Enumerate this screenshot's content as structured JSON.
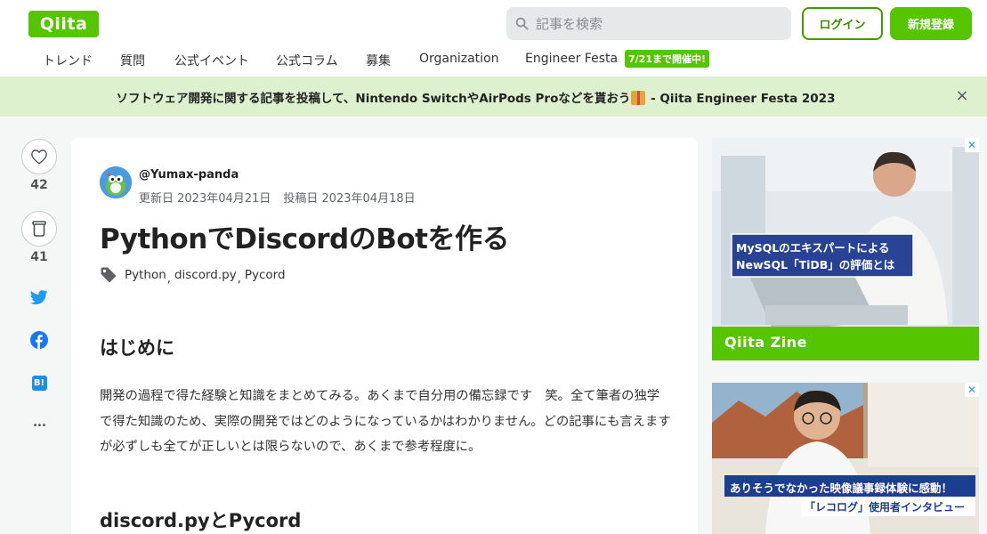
{
  "brand": {
    "logo": "Qiita",
    "accent": "#55c500"
  },
  "header": {
    "search_placeholder": "記事を検索",
    "login_label": "ログイン",
    "signup_label": "新規登録"
  },
  "nav": {
    "items": [
      "トレンド",
      "質問",
      "公式イベント",
      "公式コラム",
      "募集",
      "Organization",
      "Engineer Festa"
    ],
    "festa_badge": "7/21まで開催中!"
  },
  "banner": {
    "text_before": "ソフトウェア開発に関する記事を投稿して、Nintendo SwitchやAirPods Proなどを貰おう",
    "text_after": " - Qiita Engineer Festa 2023",
    "close_symbol": "×"
  },
  "actions": {
    "like_count": "42",
    "stock_count": "41",
    "icons": [
      "heart-icon",
      "stock-icon",
      "twitter-icon",
      "facebook-icon",
      "hatena-bookmark-icon",
      "more-icon"
    ],
    "hatena_label": "B!",
    "more_label": "•••"
  },
  "article": {
    "author": "@Yumax-panda",
    "updated": "更新日 2023年04月21日",
    "posted": "投稿日 2023年04月18日",
    "title": "PythonでDiscordのBotを作る",
    "tags": [
      "Python",
      "discord.py",
      "Pycord"
    ],
    "tag_separator": ",",
    "heading_intro": "はじめに",
    "intro_paragraph": "開発の過程で得た経験と知識をまとめてみる。あくまで自分用の備忘録です　笑。全て筆者の独学で得た知識のため、実際の開発ではどのようになっているかはわかりません。どの記事にも言えますが必ずしも全てが正しいとは限らないので、あくまで参考程度に。",
    "heading_libs": "discord.pyとPycord"
  },
  "ads": {
    "ad1": {
      "headline_1": "MySQLのエキスパートによる",
      "headline_2": "NewSQL「TiDB」の評価とは",
      "footer": "Qiita Zine"
    },
    "ad2": {
      "headline_1": "ありそうでなかった映像議事録体験に感動！",
      "headline_2": "「レコログ」使用者インタビュー"
    },
    "close_symbol": "✕"
  }
}
